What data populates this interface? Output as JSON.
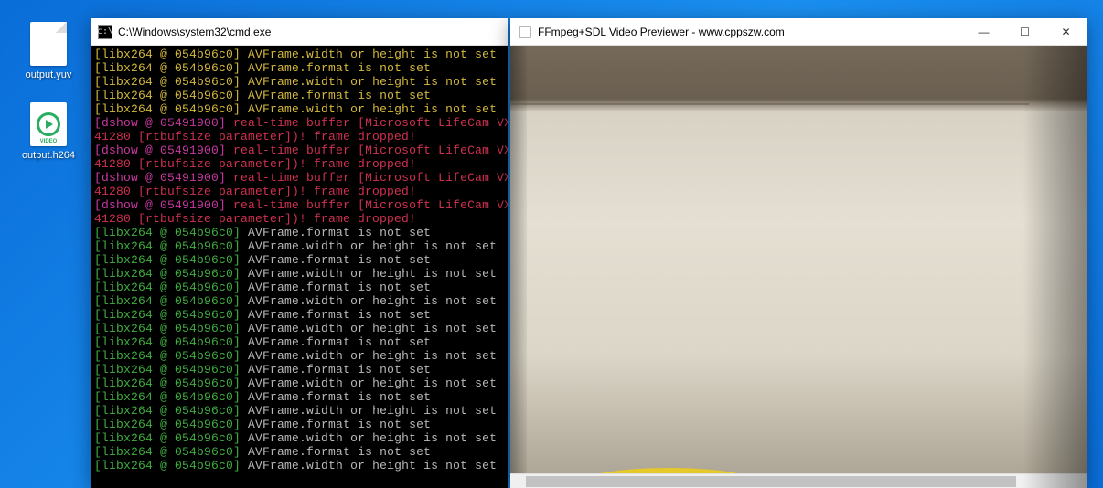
{
  "desktop": {
    "icons": [
      {
        "label": "output.yuv",
        "type": "file"
      },
      {
        "label": "output.h264",
        "type": "video"
      }
    ]
  },
  "cmd_window": {
    "title": "C:\\Windows\\system32\\cmd.exe",
    "lines": [
      {
        "tag": "[libx264 @ 054b96c0]",
        "tag_style": "tag",
        "msg": "AVFrame.width or height is not set",
        "msg_style": "msg-yellow"
      },
      {
        "tag": "[libx264 @ 054b96c0]",
        "tag_style": "tag",
        "msg": "AVFrame.format is not set",
        "msg_style": "msg-yellow"
      },
      {
        "tag": "[libx264 @ 054b96c0]",
        "tag_style": "tag",
        "msg": "AVFrame.width or height is not set",
        "msg_style": "msg-yellow"
      },
      {
        "tag": "[libx264 @ 054b96c0]",
        "tag_style": "tag",
        "msg": "AVFrame.format is not set",
        "msg_style": "msg-yellow"
      },
      {
        "tag": "[libx264 @ 054b96c0]",
        "tag_style": "tag",
        "msg": "AVFrame.width or height is not set",
        "msg_style": "msg-yellow"
      },
      {
        "tag": "[dshow @ 05491900]",
        "tag_style": "dshow-tag",
        "msg": "real-time buffer [Microsoft LifeCam VX-",
        "msg_style": "dshow-msg"
      },
      {
        "tag": "41280 [rtbufsize parameter])! frame dropped!",
        "tag_style": "dshow-msg",
        "msg": "",
        "msg_style": ""
      },
      {
        "tag": "[dshow @ 05491900]",
        "tag_style": "dshow-tag",
        "msg": "real-time buffer [Microsoft LifeCam VX-",
        "msg_style": "dshow-msg"
      },
      {
        "tag": "41280 [rtbufsize parameter])! frame dropped!",
        "tag_style": "dshow-msg",
        "msg": "",
        "msg_style": ""
      },
      {
        "tag": "[dshow @ 05491900]",
        "tag_style": "dshow-tag",
        "msg": "real-time buffer [Microsoft LifeCam VX-",
        "msg_style": "dshow-msg"
      },
      {
        "tag": "41280 [rtbufsize parameter])! frame dropped!",
        "tag_style": "dshow-msg",
        "msg": "",
        "msg_style": ""
      },
      {
        "tag": "[dshow @ 05491900]",
        "tag_style": "dshow-tag",
        "msg": "real-time buffer [Microsoft LifeCam VX-",
        "msg_style": "dshow-msg"
      },
      {
        "tag": "41280 [rtbufsize parameter])! frame dropped!",
        "tag_style": "dshow-msg",
        "msg": "",
        "msg_style": ""
      },
      {
        "tag": "[libx264 @ 054b96c0]",
        "tag_style": "tag-green",
        "msg": "AVFrame.format is not set",
        "msg_style": "msg-silver"
      },
      {
        "tag": "[libx264 @ 054b96c0]",
        "tag_style": "tag-green",
        "msg": "AVFrame.width or height is not set",
        "msg_style": "msg-silver"
      },
      {
        "tag": "[libx264 @ 054b96c0]",
        "tag_style": "tag-green",
        "msg": "AVFrame.format is not set",
        "msg_style": "msg-silver"
      },
      {
        "tag": "[libx264 @ 054b96c0]",
        "tag_style": "tag-green",
        "msg": "AVFrame.width or height is not set",
        "msg_style": "msg-silver"
      },
      {
        "tag": "[libx264 @ 054b96c0]",
        "tag_style": "tag-green",
        "msg": "AVFrame.format is not set",
        "msg_style": "msg-silver"
      },
      {
        "tag": "[libx264 @ 054b96c0]",
        "tag_style": "tag-green",
        "msg": "AVFrame.width or height is not set",
        "msg_style": "msg-silver"
      },
      {
        "tag": "[libx264 @ 054b96c0]",
        "tag_style": "tag-green",
        "msg": "AVFrame.format is not set",
        "msg_style": "msg-silver"
      },
      {
        "tag": "[libx264 @ 054b96c0]",
        "tag_style": "tag-green",
        "msg": "AVFrame.width or height is not set",
        "msg_style": "msg-silver"
      },
      {
        "tag": "[libx264 @ 054b96c0]",
        "tag_style": "tag-green",
        "msg": "AVFrame.format is not set",
        "msg_style": "msg-silver"
      },
      {
        "tag": "[libx264 @ 054b96c0]",
        "tag_style": "tag-green",
        "msg": "AVFrame.width or height is not set",
        "msg_style": "msg-silver"
      },
      {
        "tag": "[libx264 @ 054b96c0]",
        "tag_style": "tag-green",
        "msg": "AVFrame.format is not set",
        "msg_style": "msg-silver"
      },
      {
        "tag": "[libx264 @ 054b96c0]",
        "tag_style": "tag-green",
        "msg": "AVFrame.width or height is not set",
        "msg_style": "msg-silver"
      },
      {
        "tag": "[libx264 @ 054b96c0]",
        "tag_style": "tag-green",
        "msg": "AVFrame.format is not set",
        "msg_style": "msg-silver"
      },
      {
        "tag": "[libx264 @ 054b96c0]",
        "tag_style": "tag-green",
        "msg": "AVFrame.width or height is not set",
        "msg_style": "msg-silver"
      },
      {
        "tag": "[libx264 @ 054b96c0]",
        "tag_style": "tag-green",
        "msg": "AVFrame.format is not set",
        "msg_style": "msg-silver"
      },
      {
        "tag": "[libx264 @ 054b96c0]",
        "tag_style": "tag-green",
        "msg": "AVFrame.width or height is not set",
        "msg_style": "msg-silver"
      },
      {
        "tag": "[libx264 @ 054b96c0]",
        "tag_style": "tag-green",
        "msg": "AVFrame.format is not set",
        "msg_style": "msg-silver"
      },
      {
        "tag": "[libx264 @ 054b96c0]",
        "tag_style": "tag-green",
        "msg": "AVFrame.width or height is not set",
        "msg_style": "msg-silver"
      }
    ]
  },
  "preview_window": {
    "title": "FFmpeg+SDL Video Previewer - www.cppszw.com",
    "controls": {
      "min": "—",
      "max": "☐",
      "close": "✕"
    },
    "video_badge": "VIDEO"
  }
}
